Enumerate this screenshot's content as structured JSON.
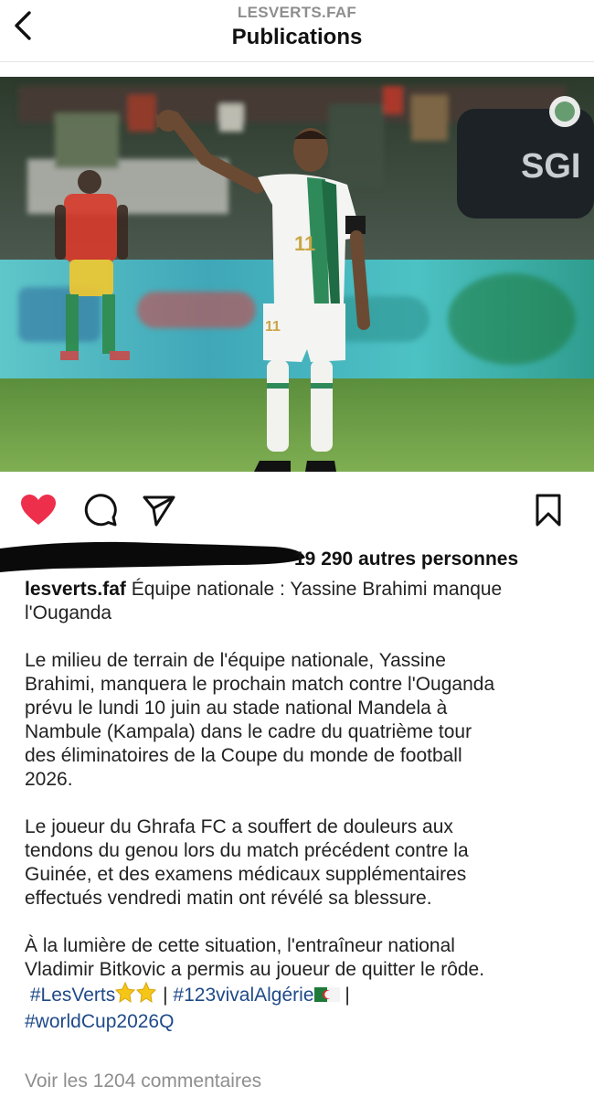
{
  "header": {
    "account": "LESVERTS.FAF",
    "title": "Publications"
  },
  "post": {
    "likes_text": "19 290 autres personnes",
    "caption": {
      "username": "lesverts.faf",
      "headline": "Équipe nationale : Yassine Brahimi manque l'Ouganda",
      "paragraph1_line1": "Le milieu de terrain de l'équipe nationale, Yassine",
      "paragraph1_line2": "Brahimi, manquera le prochain match contre l'Ouganda",
      "paragraph1_line3": "prévu le lundi 10 juin au stade national Mandela à",
      "paragraph1_line4": "Nambule (Kampala) dans le cadre du quatrième tour",
      "paragraph1_line5": "des éliminatoires de la Coupe du monde de football",
      "paragraph1_line6": "2026.",
      "paragraph2_line1": "Le joueur du Ghrafa FC a souffert de douleurs aux",
      "paragraph2_line2": "tendons du genou lors du match précédent contre la",
      "paragraph2_line3": "Guinée, et des examens médicaux supplémentaires",
      "paragraph2_line4": "effectués vendredi matin ont révélé sa blessure.",
      "paragraph3_line1": "À la lumière de cette situation, l'entraîneur national",
      "paragraph3_line2": "Vladimir Bitkovic a permis au joueur de quitter le rôde.",
      "hashtag1": "#LesVerts",
      "hashtag2": "#123vivalAlgérie",
      "hashtag3": "#worldCup2026Q",
      "separator": "|"
    },
    "view_comments": "Voir les 1204 commentaires",
    "photo": {
      "jersey_number": "11",
      "board_text": "SGI"
    }
  },
  "icons": {
    "back": "chevron-left-icon",
    "like": "heart-filled-icon",
    "comment": "comment-bubble-icon",
    "share": "paper-plane-icon",
    "save": "bookmark-icon"
  },
  "colors": {
    "like": "#ed2f4b",
    "hashtag": "#1f4a88",
    "muted": "#8e8e8e"
  }
}
